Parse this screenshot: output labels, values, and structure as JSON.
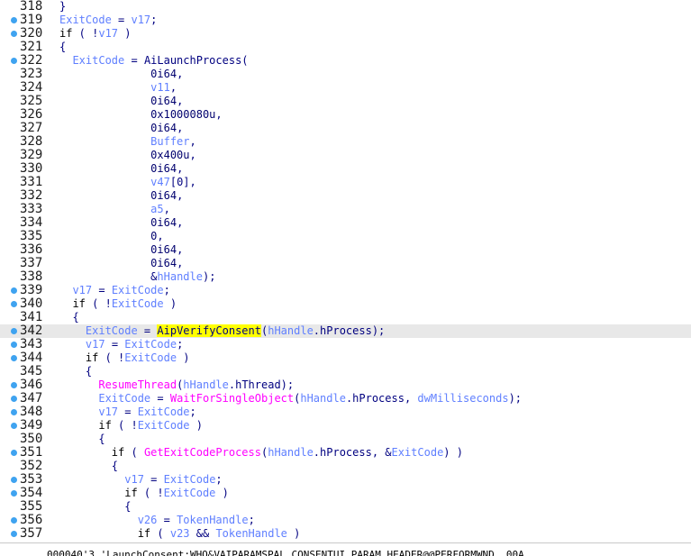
{
  "colors": {
    "variable": "#5f7fff",
    "function": "#ff00ff",
    "keyword": "#000000",
    "number": "#00006e",
    "operator": "#000080",
    "highlight_line": "#e8e8e8",
    "highlight_token": "#ffff00",
    "breakpoint_dot": "#3fa3f0"
  },
  "lines": [
    {
      "n": "318",
      "dot": false,
      "hl": false,
      "indent": "",
      "tokens": [
        [
          "op",
          "}"
        ]
      ]
    },
    {
      "n": "319",
      "dot": true,
      "hl": false,
      "indent": "",
      "tokens": [
        [
          "var",
          "ExitCode"
        ],
        [
          "op",
          " = "
        ],
        [
          "var",
          "v17"
        ],
        [
          "op",
          ";"
        ]
      ]
    },
    {
      "n": "320",
      "dot": true,
      "hl": false,
      "indent": "",
      "tokens": [
        [
          "kw",
          "if"
        ],
        [
          "op",
          " ( !"
        ],
        [
          "var",
          "v17"
        ],
        [
          "op",
          " )"
        ]
      ]
    },
    {
      "n": "321",
      "dot": false,
      "hl": false,
      "indent": "",
      "tokens": [
        [
          "op",
          "{"
        ]
      ]
    },
    {
      "n": "322",
      "dot": true,
      "hl": false,
      "indent": "  ",
      "tokens": [
        [
          "var",
          "ExitCode"
        ],
        [
          "op",
          " = "
        ],
        [
          "op",
          "AiLaunchProcess("
        ]
      ]
    },
    {
      "n": "323",
      "dot": false,
      "hl": false,
      "indent": "              ",
      "tokens": [
        [
          "num",
          "0i64"
        ],
        [
          "op",
          ","
        ]
      ]
    },
    {
      "n": "324",
      "dot": false,
      "hl": false,
      "indent": "              ",
      "tokens": [
        [
          "var",
          "v11"
        ],
        [
          "op",
          ","
        ]
      ]
    },
    {
      "n": "325",
      "dot": false,
      "hl": false,
      "indent": "              ",
      "tokens": [
        [
          "num",
          "0i64"
        ],
        [
          "op",
          ","
        ]
      ]
    },
    {
      "n": "326",
      "dot": false,
      "hl": false,
      "indent": "              ",
      "tokens": [
        [
          "num",
          "0x1000080u"
        ],
        [
          "op",
          ","
        ]
      ]
    },
    {
      "n": "327",
      "dot": false,
      "hl": false,
      "indent": "              ",
      "tokens": [
        [
          "num",
          "0i64"
        ],
        [
          "op",
          ","
        ]
      ]
    },
    {
      "n": "328",
      "dot": false,
      "hl": false,
      "indent": "              ",
      "tokens": [
        [
          "var",
          "Buffer"
        ],
        [
          "op",
          ","
        ]
      ]
    },
    {
      "n": "329",
      "dot": false,
      "hl": false,
      "indent": "              ",
      "tokens": [
        [
          "num",
          "0x400u"
        ],
        [
          "op",
          ","
        ]
      ]
    },
    {
      "n": "330",
      "dot": false,
      "hl": false,
      "indent": "              ",
      "tokens": [
        [
          "num",
          "0i64"
        ],
        [
          "op",
          ","
        ]
      ]
    },
    {
      "n": "331",
      "dot": false,
      "hl": false,
      "indent": "              ",
      "tokens": [
        [
          "var",
          "v47"
        ],
        [
          "op",
          "[0],"
        ]
      ]
    },
    {
      "n": "332",
      "dot": false,
      "hl": false,
      "indent": "              ",
      "tokens": [
        [
          "num",
          "0i64"
        ],
        [
          "op",
          ","
        ]
      ]
    },
    {
      "n": "333",
      "dot": false,
      "hl": false,
      "indent": "              ",
      "tokens": [
        [
          "var",
          "a5"
        ],
        [
          "op",
          ","
        ]
      ]
    },
    {
      "n": "334",
      "dot": false,
      "hl": false,
      "indent": "              ",
      "tokens": [
        [
          "num",
          "0i64"
        ],
        [
          "op",
          ","
        ]
      ]
    },
    {
      "n": "335",
      "dot": false,
      "hl": false,
      "indent": "              ",
      "tokens": [
        [
          "num",
          "0"
        ],
        [
          "op",
          ","
        ]
      ]
    },
    {
      "n": "336",
      "dot": false,
      "hl": false,
      "indent": "              ",
      "tokens": [
        [
          "num",
          "0i64"
        ],
        [
          "op",
          ","
        ]
      ]
    },
    {
      "n": "337",
      "dot": false,
      "hl": false,
      "indent": "              ",
      "tokens": [
        [
          "num",
          "0i64"
        ],
        [
          "op",
          ","
        ]
      ]
    },
    {
      "n": "338",
      "dot": false,
      "hl": false,
      "indent": "              ",
      "tokens": [
        [
          "op",
          "&"
        ],
        [
          "var",
          "hHandle"
        ],
        [
          "op",
          ");"
        ]
      ]
    },
    {
      "n": "339",
      "dot": true,
      "hl": false,
      "indent": "  ",
      "tokens": [
        [
          "var",
          "v17"
        ],
        [
          "op",
          " = "
        ],
        [
          "var",
          "ExitCode"
        ],
        [
          "op",
          ";"
        ]
      ]
    },
    {
      "n": "340",
      "dot": true,
      "hl": false,
      "indent": "  ",
      "tokens": [
        [
          "kw",
          "if"
        ],
        [
          "op",
          " ( !"
        ],
        [
          "var",
          "ExitCode"
        ],
        [
          "op",
          " )"
        ]
      ]
    },
    {
      "n": "341",
      "dot": false,
      "hl": false,
      "indent": "  ",
      "tokens": [
        [
          "op",
          "{"
        ]
      ]
    },
    {
      "n": "342",
      "dot": true,
      "hl": true,
      "indent": "    ",
      "tokens": [
        [
          "var",
          "ExitCode"
        ],
        [
          "op",
          " = "
        ],
        [
          "mark",
          "AipVerifyConsent"
        ],
        [
          "op",
          "("
        ],
        [
          "var",
          "hHandle"
        ],
        [
          "op",
          ".hProcess);"
        ]
      ]
    },
    {
      "n": "343",
      "dot": true,
      "hl": false,
      "indent": "    ",
      "tokens": [
        [
          "var",
          "v17"
        ],
        [
          "op",
          " = "
        ],
        [
          "var",
          "ExitCode"
        ],
        [
          "op",
          ";"
        ]
      ]
    },
    {
      "n": "344",
      "dot": true,
      "hl": false,
      "indent": "    ",
      "tokens": [
        [
          "kw",
          "if"
        ],
        [
          "op",
          " ( !"
        ],
        [
          "var",
          "ExitCode"
        ],
        [
          "op",
          " )"
        ]
      ]
    },
    {
      "n": "345",
      "dot": false,
      "hl": false,
      "indent": "    ",
      "tokens": [
        [
          "op",
          "{"
        ]
      ]
    },
    {
      "n": "346",
      "dot": true,
      "hl": false,
      "indent": "      ",
      "tokens": [
        [
          "fn",
          "ResumeThread"
        ],
        [
          "op",
          "("
        ],
        [
          "var",
          "hHandle"
        ],
        [
          "op",
          ".hThread);"
        ]
      ]
    },
    {
      "n": "347",
      "dot": true,
      "hl": false,
      "indent": "      ",
      "tokens": [
        [
          "var",
          "ExitCode"
        ],
        [
          "op",
          " = "
        ],
        [
          "fn",
          "WaitForSingleObject"
        ],
        [
          "op",
          "("
        ],
        [
          "var",
          "hHandle"
        ],
        [
          "op",
          ".hProcess, "
        ],
        [
          "var",
          "dwMilliseconds"
        ],
        [
          "op",
          ");"
        ]
      ]
    },
    {
      "n": "348",
      "dot": true,
      "hl": false,
      "indent": "      ",
      "tokens": [
        [
          "var",
          "v17"
        ],
        [
          "op",
          " = "
        ],
        [
          "var",
          "ExitCode"
        ],
        [
          "op",
          ";"
        ]
      ]
    },
    {
      "n": "349",
      "dot": true,
      "hl": false,
      "indent": "      ",
      "tokens": [
        [
          "kw",
          "if"
        ],
        [
          "op",
          " ( !"
        ],
        [
          "var",
          "ExitCode"
        ],
        [
          "op",
          " )"
        ]
      ]
    },
    {
      "n": "350",
      "dot": false,
      "hl": false,
      "indent": "      ",
      "tokens": [
        [
          "op",
          "{"
        ]
      ]
    },
    {
      "n": "351",
      "dot": true,
      "hl": false,
      "indent": "        ",
      "tokens": [
        [
          "kw",
          "if"
        ],
        [
          "op",
          " ( "
        ],
        [
          "fn",
          "GetExitCodeProcess"
        ],
        [
          "op",
          "("
        ],
        [
          "var",
          "hHandle"
        ],
        [
          "op",
          ".hProcess, &"
        ],
        [
          "var",
          "ExitCode"
        ],
        [
          "op",
          ") )"
        ]
      ]
    },
    {
      "n": "352",
      "dot": false,
      "hl": false,
      "indent": "        ",
      "tokens": [
        [
          "op",
          "{"
        ]
      ]
    },
    {
      "n": "353",
      "dot": true,
      "hl": false,
      "indent": "          ",
      "tokens": [
        [
          "var",
          "v17"
        ],
        [
          "op",
          " = "
        ],
        [
          "var",
          "ExitCode"
        ],
        [
          "op",
          ";"
        ]
      ]
    },
    {
      "n": "354",
      "dot": true,
      "hl": false,
      "indent": "          ",
      "tokens": [
        [
          "kw",
          "if"
        ],
        [
          "op",
          " ( !"
        ],
        [
          "var",
          "ExitCode"
        ],
        [
          "op",
          " )"
        ]
      ]
    },
    {
      "n": "355",
      "dot": false,
      "hl": false,
      "indent": "          ",
      "tokens": [
        [
          "op",
          "{"
        ]
      ]
    },
    {
      "n": "356",
      "dot": true,
      "hl": false,
      "indent": "            ",
      "tokens": [
        [
          "var",
          "v26"
        ],
        [
          "op",
          " = "
        ],
        [
          "var",
          "TokenHandle"
        ],
        [
          "op",
          ";"
        ]
      ]
    },
    {
      "n": "357",
      "dot": true,
      "hl": false,
      "indent": "            ",
      "tokens": [
        [
          "kw",
          "if"
        ],
        [
          "op",
          " ( "
        ],
        [
          "var",
          "v23"
        ],
        [
          "op",
          " && "
        ],
        [
          "var",
          "TokenHandle"
        ],
        [
          "op",
          " )"
        ]
      ]
    }
  ],
  "statusbar": {
    "text": "000040'3 'LaunchConsent:WHO&VAIPARAMSPAL CONSENTUI PARAM HEADER@@PERFORMWND  00A"
  }
}
